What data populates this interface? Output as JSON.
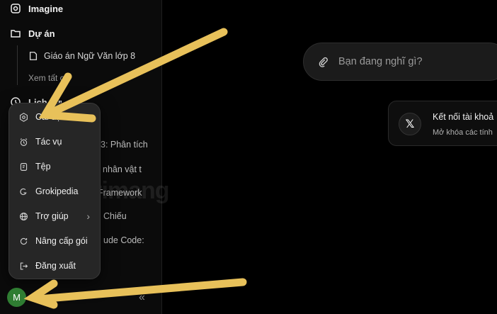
{
  "sidebar": {
    "imagine_label": "Imagine",
    "projects_label": "Dự án",
    "project_item": "Giáo án Ngữ Văn lớp 8",
    "see_all": "Xem tất c",
    "history_label": "Lịch sử",
    "history_items": [
      "3: Phân tích",
      "nhân vật t",
      "Framework",
      "Chiếu",
      "ude Code:"
    ]
  },
  "menu": {
    "items": [
      "Cài đặt",
      "Tác vụ",
      "Tệp",
      "Grokipedia",
      "Trợ giúp",
      "Nâng cấp gói",
      "Đăng xuất"
    ]
  },
  "user": {
    "avatar_initial": "M"
  },
  "main": {
    "search_placeholder": "Bạn đang nghĩ gì?",
    "card_title": "Kết nối tài khoả",
    "card_subtitle": "Mở khóa các tính"
  },
  "watermark": "Quantrimang",
  "colors": {
    "arrow": "#E8C15A",
    "avatar": "#2F7D32",
    "background": "#000000"
  }
}
